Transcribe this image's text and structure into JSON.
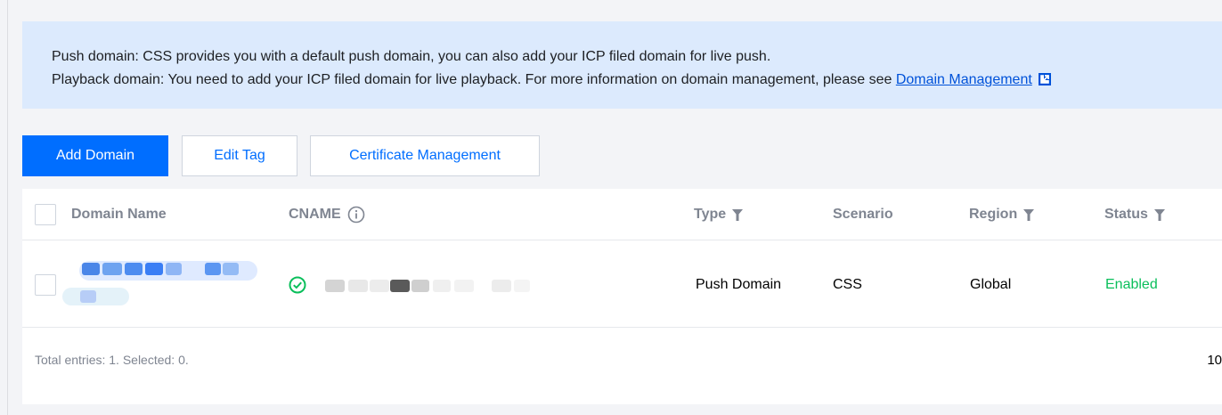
{
  "notice": {
    "line1": "Push domain: CSS provides you with a default push domain, you can also add your ICP filed domain for live push.",
    "line2_text": "Playback domain: You need to add your ICP filed domain for live playback. For more information on domain management, please see ",
    "line2_link": "Domain Management",
    "link_icon": "external-link-icon"
  },
  "toolbar": {
    "add_domain": "Add Domain",
    "edit_tag": "Edit Tag",
    "certificate_management": "Certificate Management"
  },
  "table": {
    "columns": {
      "domain_name": "Domain Name",
      "cname": "CNAME",
      "type": "Type",
      "scenario": "Scenario",
      "region": "Region",
      "status": "Status"
    },
    "rows": [
      {
        "domain_name": "",
        "cname": "",
        "cname_status_icon": "check-circle-icon",
        "type": "Push Domain",
        "scenario": "CSS",
        "region": "Global",
        "status": "Enabled"
      }
    ],
    "footer": {
      "total": "Total entries: 1. Selected: 0.",
      "page_size_partial": "10"
    }
  },
  "colors": {
    "primary": "#006eff",
    "notice_bg": "#dceafd",
    "link": "#0052d9",
    "success": "#0abf5b"
  }
}
